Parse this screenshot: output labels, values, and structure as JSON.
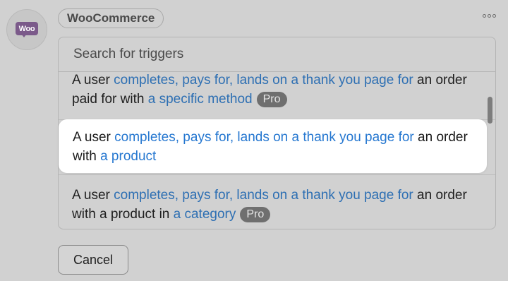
{
  "integration": {
    "logo_text": "Woo",
    "name": "WooCommerce"
  },
  "search": {
    "placeholder": "Search for triggers"
  },
  "triggers": [
    {
      "prefix": "A user ",
      "action": "completes, pays for, lands on a thank you page for",
      "middle": " an order paid for with ",
      "object": "a specific method",
      "badge": "Pro"
    },
    {
      "prefix": "A user ",
      "action": "completes, pays for, lands on a thank you page for",
      "middle": " an order with ",
      "object": "a product"
    },
    {
      "prefix": "A user ",
      "action": "completes, pays for, lands on a thank you page for",
      "middle": " an order with a product in ",
      "object": "a category",
      "badge": "Pro"
    }
  ],
  "footer": {
    "cancel_label": "Cancel"
  }
}
